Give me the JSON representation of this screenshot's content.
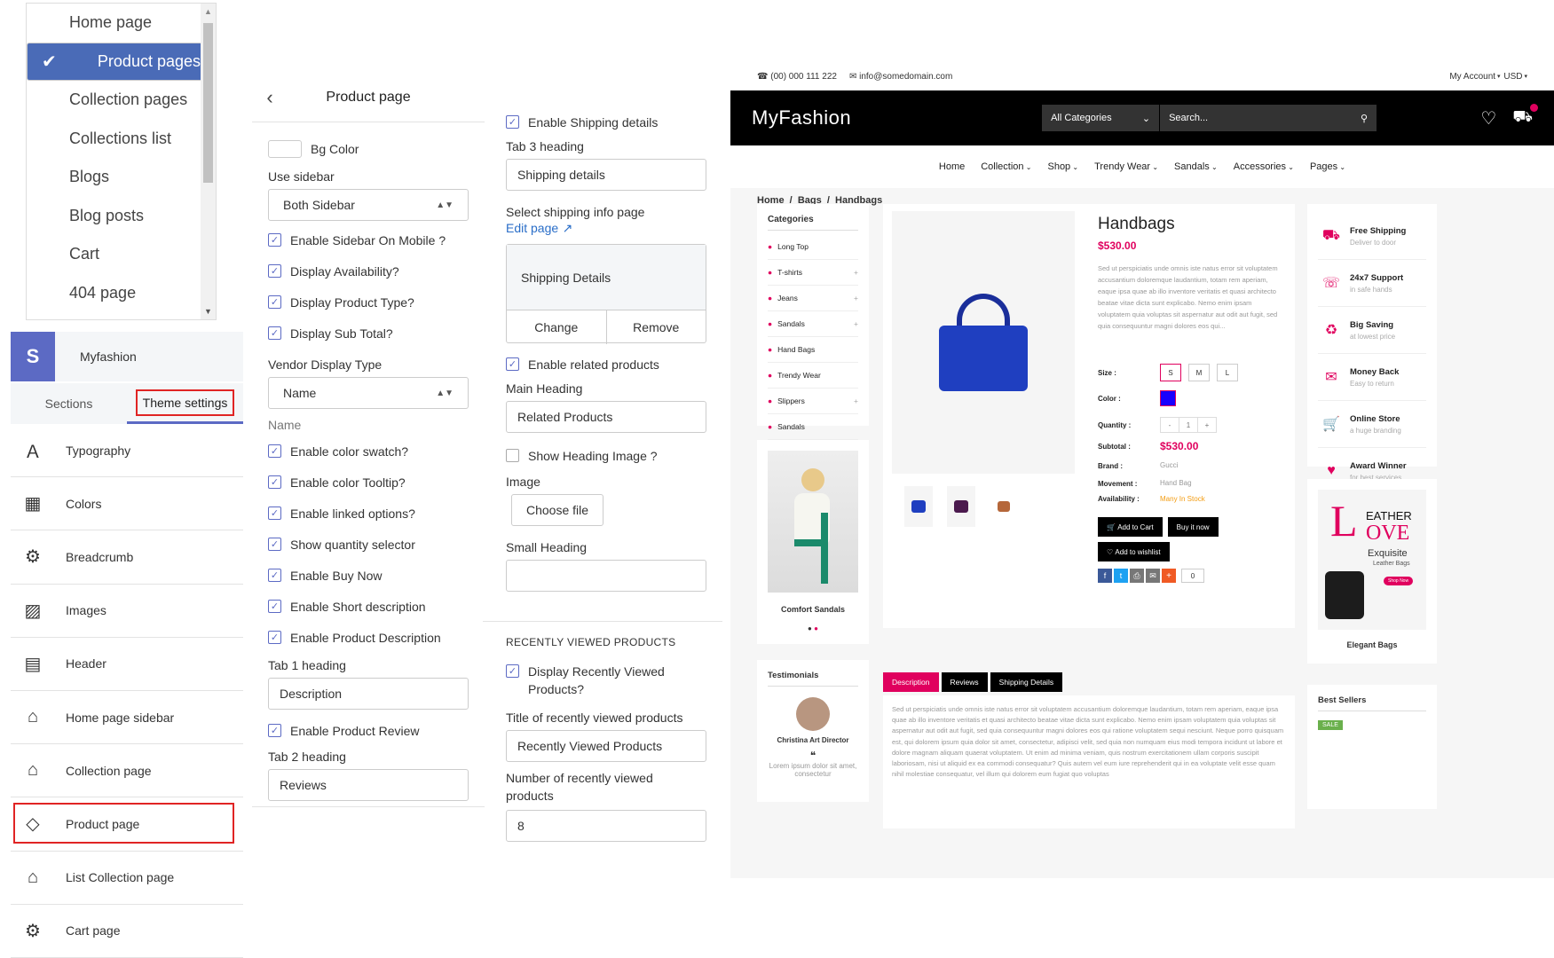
{
  "dropdown": {
    "items": [
      "Home page",
      "Product pages",
      "Collection pages",
      "Collections list",
      "Blogs",
      "Blog posts",
      "Cart",
      "404 page"
    ],
    "selected_index": 1
  },
  "sidebar": {
    "store_name": "Myfashion",
    "tabs": [
      "Sections",
      "Theme settings"
    ],
    "items": [
      "Typography",
      "Colors",
      "Breadcrumb",
      "Images",
      "Header",
      "Home page sidebar",
      "Collection page",
      "Product page",
      "List Collection page",
      "Cart page"
    ],
    "highlighted": "Product page"
  },
  "product_settings": {
    "title": "Product page",
    "bg_color_label": "Bg Color",
    "use_sidebar_label": "Use sidebar",
    "use_sidebar_value": "Both Sidebar",
    "checks1": [
      "Enable Sidebar On Mobile ?",
      "Display Availability?",
      "Display Product Type?",
      "Display Sub Total?"
    ],
    "vendor_label": "Vendor Display Type",
    "vendor_value": "Name",
    "vendor_help": "Name",
    "checks2": [
      "Enable color swatch?",
      "Enable color Tooltip?",
      "Enable linked options?",
      "Show quantity selector",
      "Enable Buy Now",
      "Enable Short description",
      "Enable Product Description"
    ],
    "tab1_label": "Tab 1 heading",
    "tab1_value": "Description",
    "review_check": "Enable Product Review",
    "tab2_label": "Tab 2 heading",
    "tab2_value": "Reviews"
  },
  "col3": {
    "ship_check": "Enable Shipping details",
    "tab3_label": "Tab 3 heading",
    "tab3_value": "Shipping details",
    "select_page_label": "Select shipping info page",
    "edit_page": "Edit page",
    "ship_box_title": "Shipping Details",
    "change": "Change",
    "remove": "Remove",
    "related_check": "Enable related products",
    "main_heading_label": "Main Heading",
    "main_heading_value": "Related Products",
    "heading_image_check": "Show Heading Image ?",
    "image_label": "Image",
    "choose_file": "Choose file",
    "small_heading_label": "Small Heading",
    "recent_section": "RECENTLY VIEWED PRODUCTS",
    "recent_check": "Display Recently Viewed Products?",
    "recent_title_label": "Title of recently viewed products",
    "recent_title_value": "Recently Viewed Products",
    "recent_num_label": "Number of recently viewed products",
    "recent_num_value": "8"
  },
  "preview": {
    "phone": "(00) 000 111 222",
    "email": "info@somedomain.com",
    "account": "My Account",
    "currency": "USD",
    "brand": "MyFashion",
    "all_categories": "All Categories",
    "search_placeholder": "Search...",
    "nav": [
      "Home",
      "Collection",
      "Shop",
      "Trendy Wear",
      "Sandals",
      "Accessories",
      "Pages"
    ],
    "breadcrumb": [
      "Home",
      "Bags",
      "Handbags"
    ],
    "categories_title": "Categories",
    "categories": [
      "Long Top",
      "T-shirts",
      "Jeans",
      "Sandals",
      "Hand Bags",
      "Trendy Wear",
      "Slippers",
      "Sandals"
    ],
    "promo_caption": "Comfort Sandals",
    "testimonials_title": "Testimonials",
    "testimonial_name": "Christina Art Director",
    "testimonial_text": "Lorem ipsum dolor sit amet, consectetur",
    "product_title": "Handbags",
    "price": "$530.00",
    "desc": "Sed ut perspiciatis unde omnis iste natus error sit voluptatem accusantium doloremque laudantium, totam rem aperiam, eaque ipsa quae ab illo inventore veritatis et quasi architecto beatae vitae dicta sunt explicabo. Nemo enim ipsam voluptatem quia voluptas sit aspernatur aut odit aut fugit, sed quia consequuntur magni dolores eos qui...",
    "size_label": "Size :",
    "sizes": [
      "S",
      "M",
      "L"
    ],
    "color_label": "Color :",
    "qty_label": "Quantity :",
    "qty": "1",
    "subtotal_label": "Subtotal :",
    "subtotal": "$530.00",
    "brand_label": "Brand :",
    "brand_value": "Gucci",
    "movement_label": "Movement :",
    "movement_value": "Hand Bag",
    "avail_label": "Availability :",
    "avail_value": "Many In Stock",
    "add_to_cart": "Add to Cart",
    "buy_now": "Buy it now",
    "wishlist": "Add to wishlist",
    "share_count": "0",
    "tabs": [
      "Description",
      "Reviews",
      "Shipping Details"
    ],
    "tab_text": "Sed ut perspiciatis unde omnis iste natus error sit voluptatem accusantium doloremque laudantium, totam rem aperiam, eaque ipsa quae ab illo inventore veritatis et quasi architecto beatae vitae dicta sunt explicabo. Nemo enim ipsam voluptatem quia voluptas sit aspernatur aut odit aut fugit, sed quia consequuntur magni dolores eos qui ratione voluptatem sequi nesciunt. Neque porro quisquam est, qui dolorem ipsum quia dolor sit amet, consectetur, adipisci velit, sed quia non numquam eius modi tempora incidunt ut labore et dolore magnam aliquam quaerat voluptatem. Ut enim ad minima veniam, quis nostrum exercitationem ullam corporis suscipit laboriosam, nisi ut aliquid ex ea commodi consequatur? Quis autem vel eum iure reprehenderit qui in ea voluptate velit esse quam nihil molestiae consequatur, vel illum qui dolorem eum fugiat quo voluptas",
    "services": [
      {
        "t": "Free Shipping",
        "s": "Deliver to door"
      },
      {
        "t": "24x7 Support",
        "s": "in safe hands"
      },
      {
        "t": "Big Saving",
        "s": "at lowest price"
      },
      {
        "t": "Money Back",
        "s": "Easy to return"
      },
      {
        "t": "Online Store",
        "s": "a huge branding"
      },
      {
        "t": "Award Winner",
        "s": "for best services"
      }
    ],
    "banner_big": "L",
    "banner_word1": "EATHER",
    "banner_word2": "OVE",
    "banner_exq": "Exquisite",
    "banner_sub": "Leather Bags",
    "banner_btn": "Shop Now",
    "banner_caption": "Elegant Bags",
    "best_sellers": "Best Sellers",
    "sale": "SALE",
    "accent": "#e0005e"
  }
}
